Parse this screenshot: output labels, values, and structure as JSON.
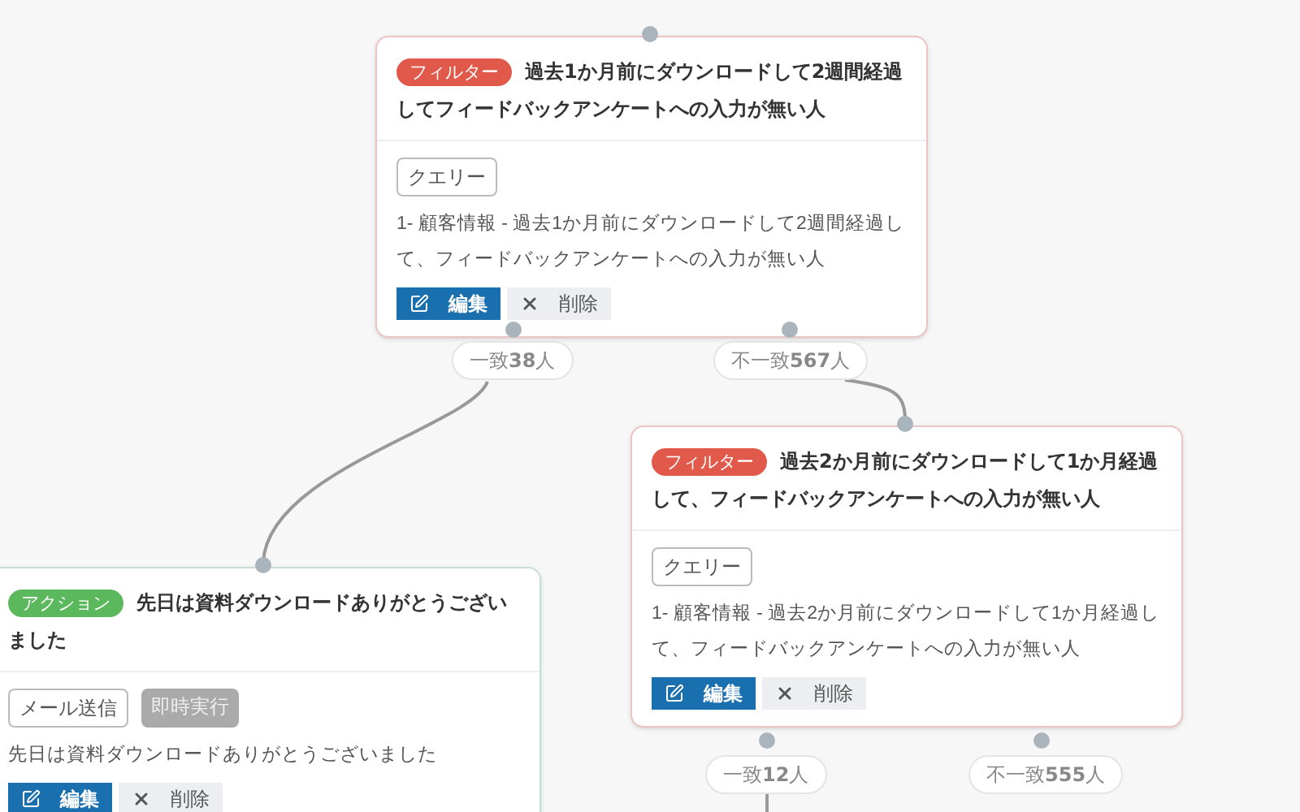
{
  "nodes": [
    {
      "kind": "filter",
      "badge": "フィルター",
      "title": "過去1か月前にダウンロードして2週間経過してフィードバックアンケートへの入力が無い人",
      "tags": [
        {
          "kind": "outline",
          "label": "クエリー"
        }
      ],
      "description": "1- 顧客情報 - 過去1か月前にダウンロードして2週間経過して、フィードバックアンケートへの入力が無い人",
      "edit": "編集",
      "delete": "削除"
    },
    {
      "kind": "action",
      "badge": "アクション",
      "title": "先日は資料ダウンロードありがとうございました",
      "tags": [
        {
          "kind": "outline",
          "label": "メール送信"
        },
        {
          "kind": "muted",
          "label": "即時実行"
        }
      ],
      "description": "先日は資料ダウンロードありがとうございました",
      "edit": "編集",
      "delete": "削除"
    },
    {
      "kind": "filter",
      "badge": "フィルター",
      "title": "過去2か月前にダウンロードして1か月経過して、フィードバックアンケートへの入力が無い人",
      "tags": [
        {
          "kind": "outline",
          "label": "クエリー"
        }
      ],
      "description": "1- 顧客情報 - 過去2か月前にダウンロードして1か月経過して、フィードバックアンケートへの入力が無い人",
      "edit": "編集",
      "delete": "削除"
    }
  ],
  "branches": [
    {
      "label": "一致**38**人"
    },
    {
      "label": "不一致**567**人"
    },
    {
      "label": "一致**12**人"
    },
    {
      "label": "不一致**555**人"
    }
  ]
}
